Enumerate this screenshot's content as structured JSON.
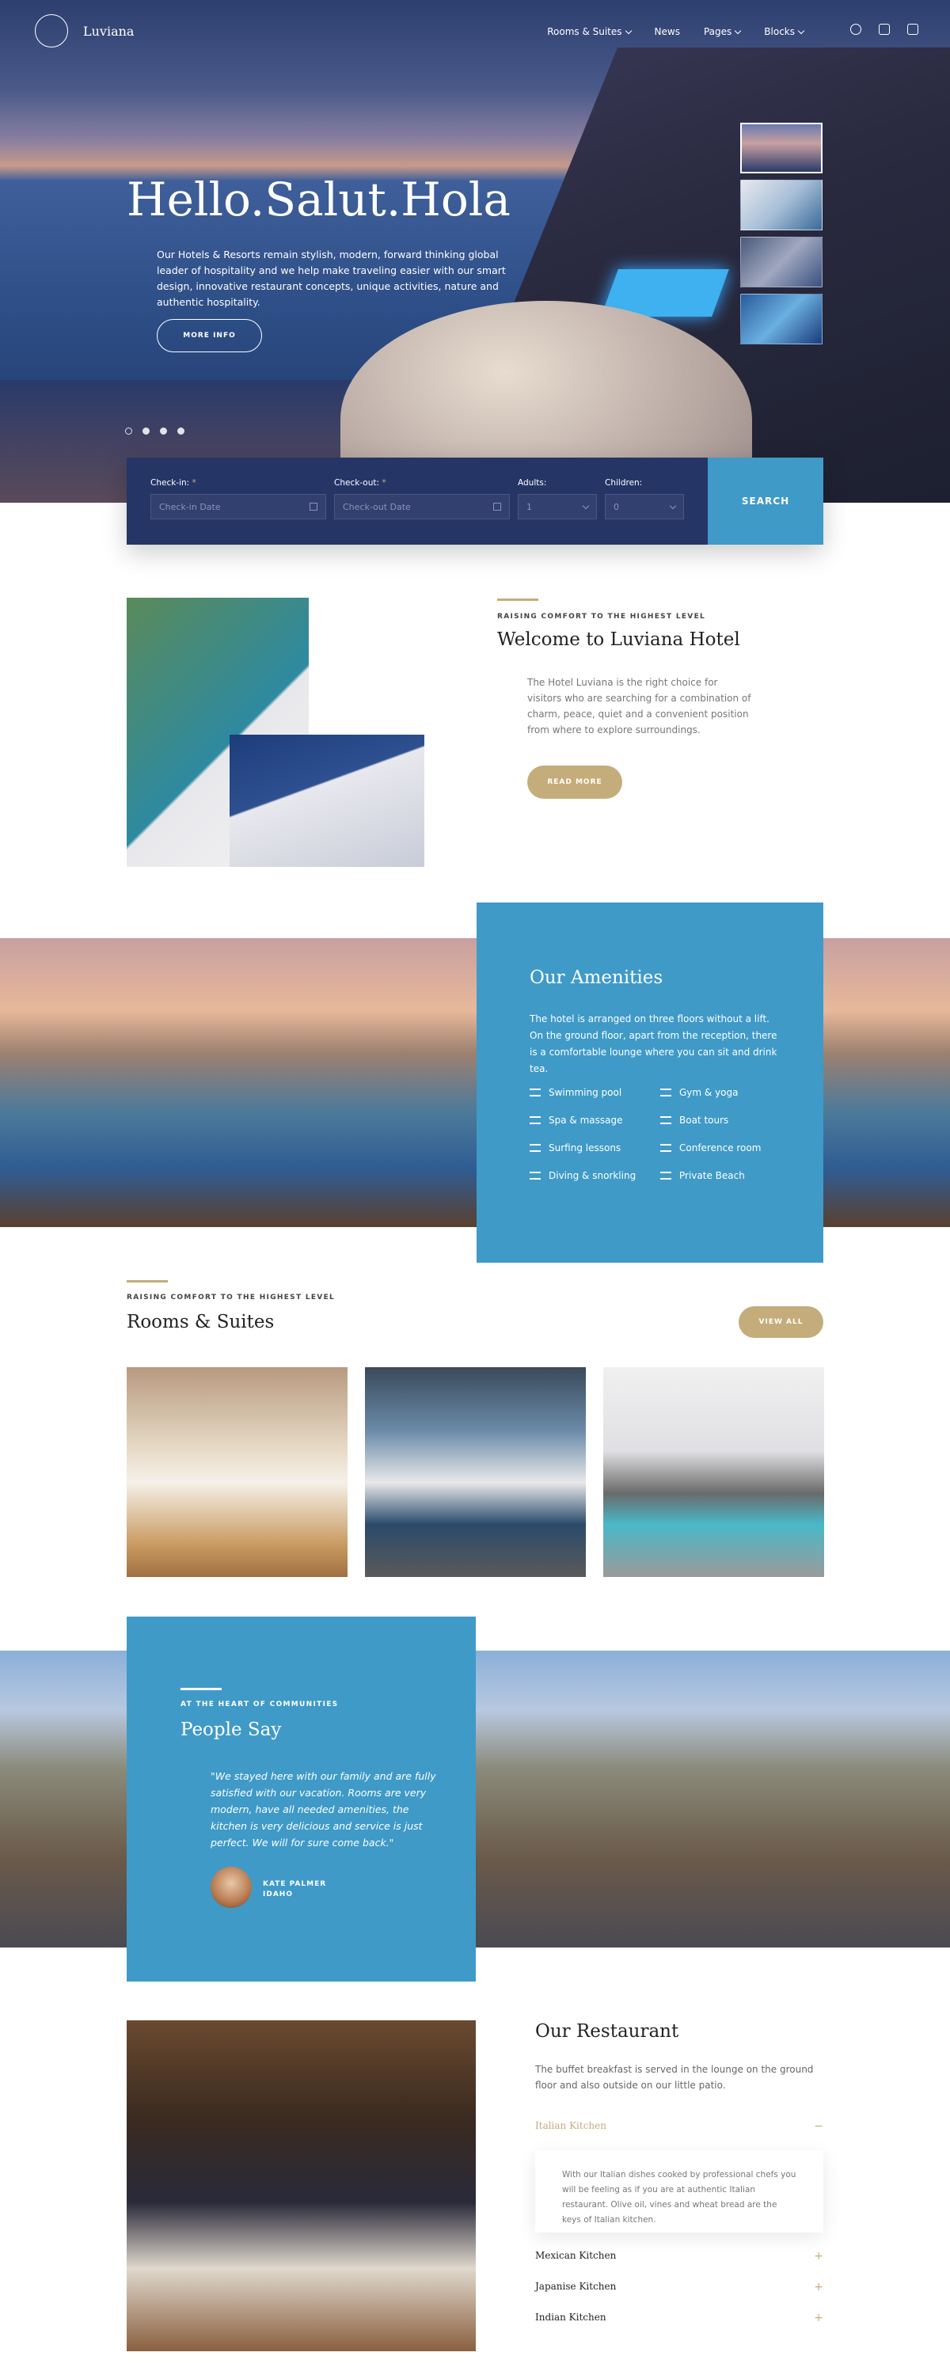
{
  "nav": {
    "logo_text": "Luviana",
    "menu": [
      {
        "label": "Rooms & Suites",
        "has_dropdown": true
      },
      {
        "label": "News",
        "has_dropdown": false
      },
      {
        "label": "Pages",
        "has_dropdown": true
      },
      {
        "label": "Blocks",
        "has_dropdown": true
      }
    ],
    "social_icons": [
      "tripadvisor-icon",
      "foursquare-icon",
      "instagram-icon"
    ]
  },
  "hero": {
    "title": "Hello.Salut.Hola",
    "text": "Our Hotels & Resorts remain stylish, modern, forward thinking global leader of hospitality and we help make traveling easier with our smart design, innovative restaurant concepts, unique activities, nature and authentic hospitality.",
    "button": "MORE INFO",
    "slide_count": 4,
    "active_slide": 1
  },
  "booking": {
    "checkin_label": "Check-in:",
    "checkin_placeholder": "Check-in Date",
    "checkout_label": "Check-out:",
    "checkout_placeholder": "Check-out Date",
    "adults_label": "Adults:",
    "adults_value": "1",
    "children_label": "Children:",
    "children_value": "0",
    "required_mark": "*",
    "search_button": "SEARCH"
  },
  "welcome": {
    "eyebrow": "RAISING COMFORT TO THE HIGHEST LEVEL",
    "title": "Welcome to Luviana Hotel",
    "text": "The Hotel Luviana is the right choice for visitors who are searching for a combination of charm, peace, quiet and a convenient position from where to explore surroundings.",
    "button": "READ MORE"
  },
  "amenities": {
    "title": "Our Amenities",
    "text": "The hotel is arranged on three floors without a lift. On the ground floor, apart from the reception, there is a comfortable lounge where you can sit and drink tea.",
    "items": [
      "Swimming pool",
      "Gym & yoga",
      "Spa & massage",
      "Boat tours",
      "Surfing lessons",
      "Conference room",
      "Diving & snorkling",
      "Private Beach"
    ]
  },
  "rooms": {
    "eyebrow": "RAISING COMFORT TO THE HIGHEST LEVEL",
    "title": "Rooms & Suites",
    "button": "VIEW ALL"
  },
  "testimonial": {
    "eyebrow": "AT THE HEART OF COMMUNITIES",
    "title": "People Say",
    "quote": "\"We stayed here with our family and are fully satisfied with our vacation. Rooms are very modern, have all needed amenities, the kitchen is very delicious and service is just perfect. We will for sure come back.\"",
    "author": "KATE PALMER",
    "location": "IDAHO"
  },
  "restaurant": {
    "title": "Our Restaurant",
    "text": "The buffet breakfast is served in the lounge on the ground floor and also outside on our little patio.",
    "tabs": [
      {
        "label": "Italian Kitchen",
        "expanded": true,
        "content": "With our Italian dishes cooked by professional chefs you will be feeling as if you are at authentic Italian restaurant. Olive oil, vines and wheat bread are the keys of Italian kitchen."
      },
      {
        "label": "Mexican Kitchen",
        "expanded": false
      },
      {
        "label": "Japanise Kitchen",
        "expanded": false
      },
      {
        "label": "Indian Kitchen",
        "expanded": false
      }
    ],
    "collapse_symbol": "−",
    "expand_symbol": "+"
  },
  "colors": {
    "primary_blue": "#3f9ac8",
    "navy": "#253566",
    "gold": "#c4ad7b"
  }
}
